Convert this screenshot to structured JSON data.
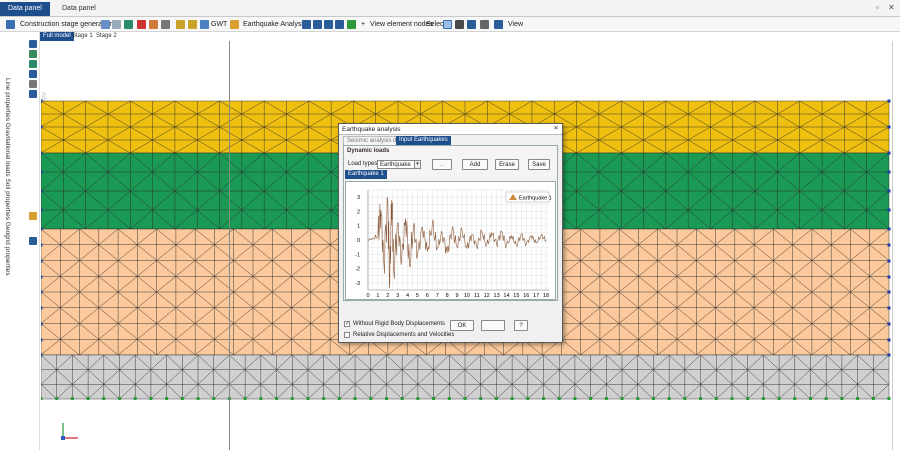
{
  "tabs": [
    {
      "label": "Data panel plot",
      "active": true
    },
    {
      "label": "Data panel text",
      "active": false
    }
  ],
  "toolbar": {
    "construction_stage": "Construction stage generation",
    "gwt": "GWT",
    "earthquake_analysis": "Earthquake Analysis",
    "view_element_nodes": "View element nodes",
    "select": "Select",
    "view": "View"
  },
  "stages": [
    {
      "label": "Full model",
      "active": true
    },
    {
      "label": "Stage 1",
      "active": false
    },
    {
      "label": "Stage 2",
      "active": false
    }
  ],
  "left_panel": {
    "items_text": "Line properties Gravitational loads Soil properties Geogrid properties",
    "secondary_text": "Add frames Lineloads Add lineelements Geoline..."
  },
  "layers": [
    {
      "name": "yellow",
      "color": "#f0c010"
    },
    {
      "name": "green",
      "color": "#1a9a55"
    },
    {
      "name": "orange",
      "color": "#fbc99b"
    },
    {
      "name": "gray",
      "color": "#d0d0d0"
    }
  ],
  "dialog": {
    "title": "Earthquake analysis",
    "tabs": [
      {
        "label": "Seismic analysis data",
        "active": false
      },
      {
        "label": "Input Earthquakes",
        "active": true
      }
    ],
    "group_title": "Dynamic loads",
    "load_types_label": "Load types",
    "load_type_value": "Earthquake",
    "buttons": {
      "dots": "...",
      "add": "Add",
      "erase": "Erase",
      "save": "Save",
      "ok": "OK",
      "cancel": "",
      "help": "?"
    },
    "chart_tab": "Earthquake 1",
    "checkbox1": {
      "label": "Without Rigid Body Displacements",
      "checked": true
    },
    "checkbox2": {
      "label": "Relative Displacements and Velocities",
      "checked": false
    }
  },
  "chart_data": {
    "type": "line",
    "series": [
      {
        "name": "Earthquake 1",
        "color": "#8b5a3a"
      }
    ],
    "x_ticks": [
      "0",
      "1",
      "2",
      "3",
      "4",
      "5",
      "6",
      "7",
      "8",
      "9",
      "10",
      "11",
      "12",
      "13",
      "14",
      "15",
      "16",
      "17",
      "18"
    ],
    "y_ticks": [
      "3",
      "2",
      "1",
      "0",
      "-1",
      "-2",
      "-3"
    ],
    "xlim": [
      0,
      18.3
    ],
    "ylim": [
      -3.5,
      3.5
    ],
    "grid": true,
    "legend": "top-right",
    "x": [
      0,
      0.5,
      1,
      1.3,
      1.6,
      2,
      2.2,
      2.4,
      2.6,
      3,
      3.4,
      3.8,
      4.2,
      4.6,
      5,
      5.5,
      6,
      6.5,
      7,
      7.5,
      8,
      8.5,
      9,
      9.5,
      10,
      10.5,
      11,
      11.5,
      12,
      12.5,
      13,
      13.5,
      14,
      14.5,
      15,
      15.5,
      16,
      16.5,
      17,
      17.5,
      18
    ],
    "y": [
      0,
      0.1,
      0.3,
      2.1,
      -1.6,
      2.7,
      -3.0,
      2.8,
      -2.2,
      1.2,
      -1.4,
      1.5,
      -1.8,
      1.0,
      -1.1,
      0.9,
      -0.8,
      1.1,
      -0.6,
      0.5,
      -0.9,
      0.8,
      -0.5,
      0.7,
      -0.6,
      0.4,
      -0.5,
      0.6,
      -0.4,
      0.5,
      -0.3,
      0.6,
      -0.4,
      0.3,
      -0.4,
      0.4,
      -0.3,
      0.3,
      -0.2,
      0.3,
      0.0
    ]
  }
}
